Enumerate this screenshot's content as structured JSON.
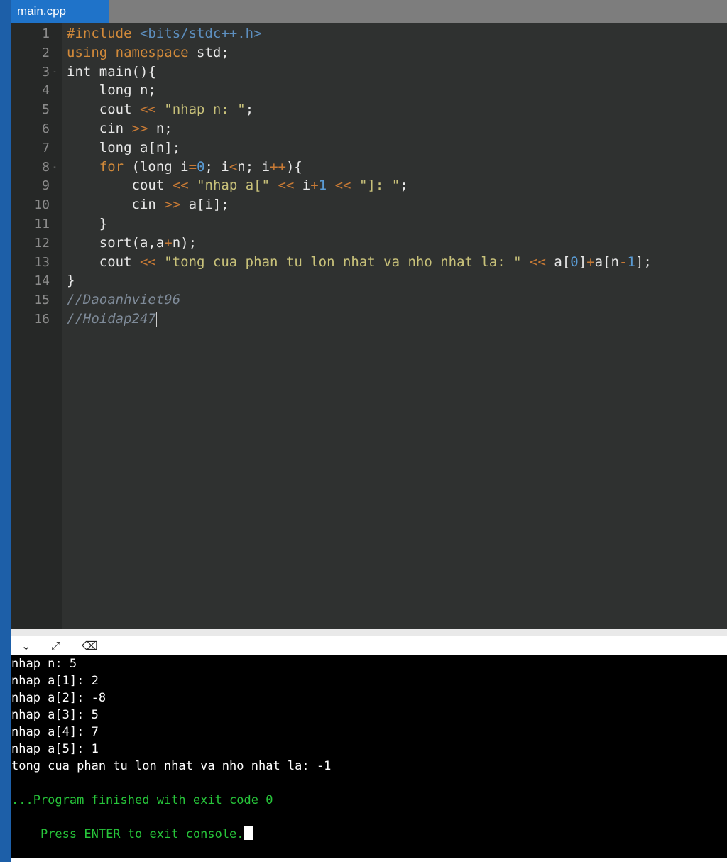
{
  "tab": {
    "label": "main.cpp"
  },
  "editor": {
    "lines": [
      {
        "n": "1",
        "fold": ""
      },
      {
        "n": "2",
        "fold": ""
      },
      {
        "n": "3",
        "fold": "-"
      },
      {
        "n": "4",
        "fold": ""
      },
      {
        "n": "5",
        "fold": ""
      },
      {
        "n": "6",
        "fold": ""
      },
      {
        "n": "7",
        "fold": ""
      },
      {
        "n": "8",
        "fold": "-"
      },
      {
        "n": "9",
        "fold": ""
      },
      {
        "n": "10",
        "fold": ""
      },
      {
        "n": "11",
        "fold": ""
      },
      {
        "n": "12",
        "fold": ""
      },
      {
        "n": "13",
        "fold": ""
      },
      {
        "n": "14",
        "fold": ""
      },
      {
        "n": "15",
        "fold": ""
      },
      {
        "n": "16",
        "fold": ""
      }
    ],
    "code": [
      [
        [
          "#include",
          "preproc"
        ],
        [
          " ",
          ""
        ],
        [
          "<bits/stdc++.h>",
          "header"
        ]
      ],
      [
        [
          "using",
          "keyword"
        ],
        [
          " ",
          ""
        ],
        [
          "namespace",
          "keyword"
        ],
        [
          " std;",
          ""
        ]
      ],
      [
        [
          "int main(){",
          ""
        ]
      ],
      [
        [
          "    long n;",
          ""
        ]
      ],
      [
        [
          "    cout ",
          ""
        ],
        [
          "<<",
          "op"
        ],
        [
          " ",
          ""
        ],
        [
          "\"nhap n: \"",
          "str"
        ],
        [
          ";",
          ""
        ]
      ],
      [
        [
          "    cin ",
          ""
        ],
        [
          ">>",
          "op"
        ],
        [
          " n;",
          ""
        ]
      ],
      [
        [
          "    long a[n];",
          ""
        ]
      ],
      [
        [
          "    ",
          ""
        ],
        [
          "for",
          "keyword"
        ],
        [
          " (long i",
          ""
        ],
        [
          "=",
          "op"
        ],
        [
          "0",
          "num"
        ],
        [
          "; i",
          ""
        ],
        [
          "<",
          "op"
        ],
        [
          "n; i",
          ""
        ],
        [
          "++",
          "op"
        ],
        [
          "){",
          ""
        ]
      ],
      [
        [
          "        cout ",
          ""
        ],
        [
          "<<",
          "op"
        ],
        [
          " ",
          ""
        ],
        [
          "\"nhap a[\"",
          "str"
        ],
        [
          " ",
          ""
        ],
        [
          "<<",
          "op"
        ],
        [
          " i",
          ""
        ],
        [
          "+",
          "op"
        ],
        [
          "1",
          "num"
        ],
        [
          " ",
          ""
        ],
        [
          "<<",
          "op"
        ],
        [
          " ",
          ""
        ],
        [
          "\"]: \"",
          "str"
        ],
        [
          ";",
          ""
        ]
      ],
      [
        [
          "        cin ",
          ""
        ],
        [
          ">>",
          "op"
        ],
        [
          " a[i];",
          ""
        ]
      ],
      [
        [
          "    }",
          ""
        ]
      ],
      [
        [
          "    sort(a,a",
          ""
        ],
        [
          "+",
          "op"
        ],
        [
          "n);",
          ""
        ]
      ],
      [
        [
          "    cout ",
          ""
        ],
        [
          "<<",
          "op"
        ],
        [
          " ",
          ""
        ],
        [
          "\"tong cua phan tu lon nhat va nho nhat la: \"",
          "str"
        ],
        [
          " ",
          ""
        ],
        [
          "<<",
          "op"
        ],
        [
          " a[",
          ""
        ],
        [
          "0",
          "num"
        ],
        [
          "]",
          ""
        ],
        [
          "+",
          "op"
        ],
        [
          "a[n",
          ""
        ],
        [
          "-",
          "op"
        ],
        [
          "1",
          "num"
        ],
        [
          "];",
          ""
        ]
      ],
      [
        [
          "}",
          ""
        ]
      ],
      [
        [
          "//Daoanhviet96",
          "comment"
        ]
      ],
      [
        [
          "//Hoidap247",
          "comment"
        ]
      ]
    ]
  },
  "console_toolbar": {
    "icons": [
      "chevron-down-icon",
      "expand-icon",
      "clear-console-icon"
    ],
    "glyphs": [
      "⌄",
      "⤢",
      "⌫"
    ]
  },
  "console": {
    "output": [
      "nhap n: 5",
      "nhap a[1]: 2",
      "nhap a[2]: -8",
      "nhap a[3]: 5",
      "nhap a[4]: 7",
      "nhap a[5]: 1",
      "tong cua phan tu lon nhat va nho nhat la: -1"
    ],
    "status": [
      "...Program finished with exit code 0",
      "Press ENTER to exit console."
    ]
  },
  "colors": {
    "editor_bg": "#2f3130",
    "tab_active": "#1f73c9",
    "console_bg": "#000000",
    "console_status": "#27c53a"
  }
}
